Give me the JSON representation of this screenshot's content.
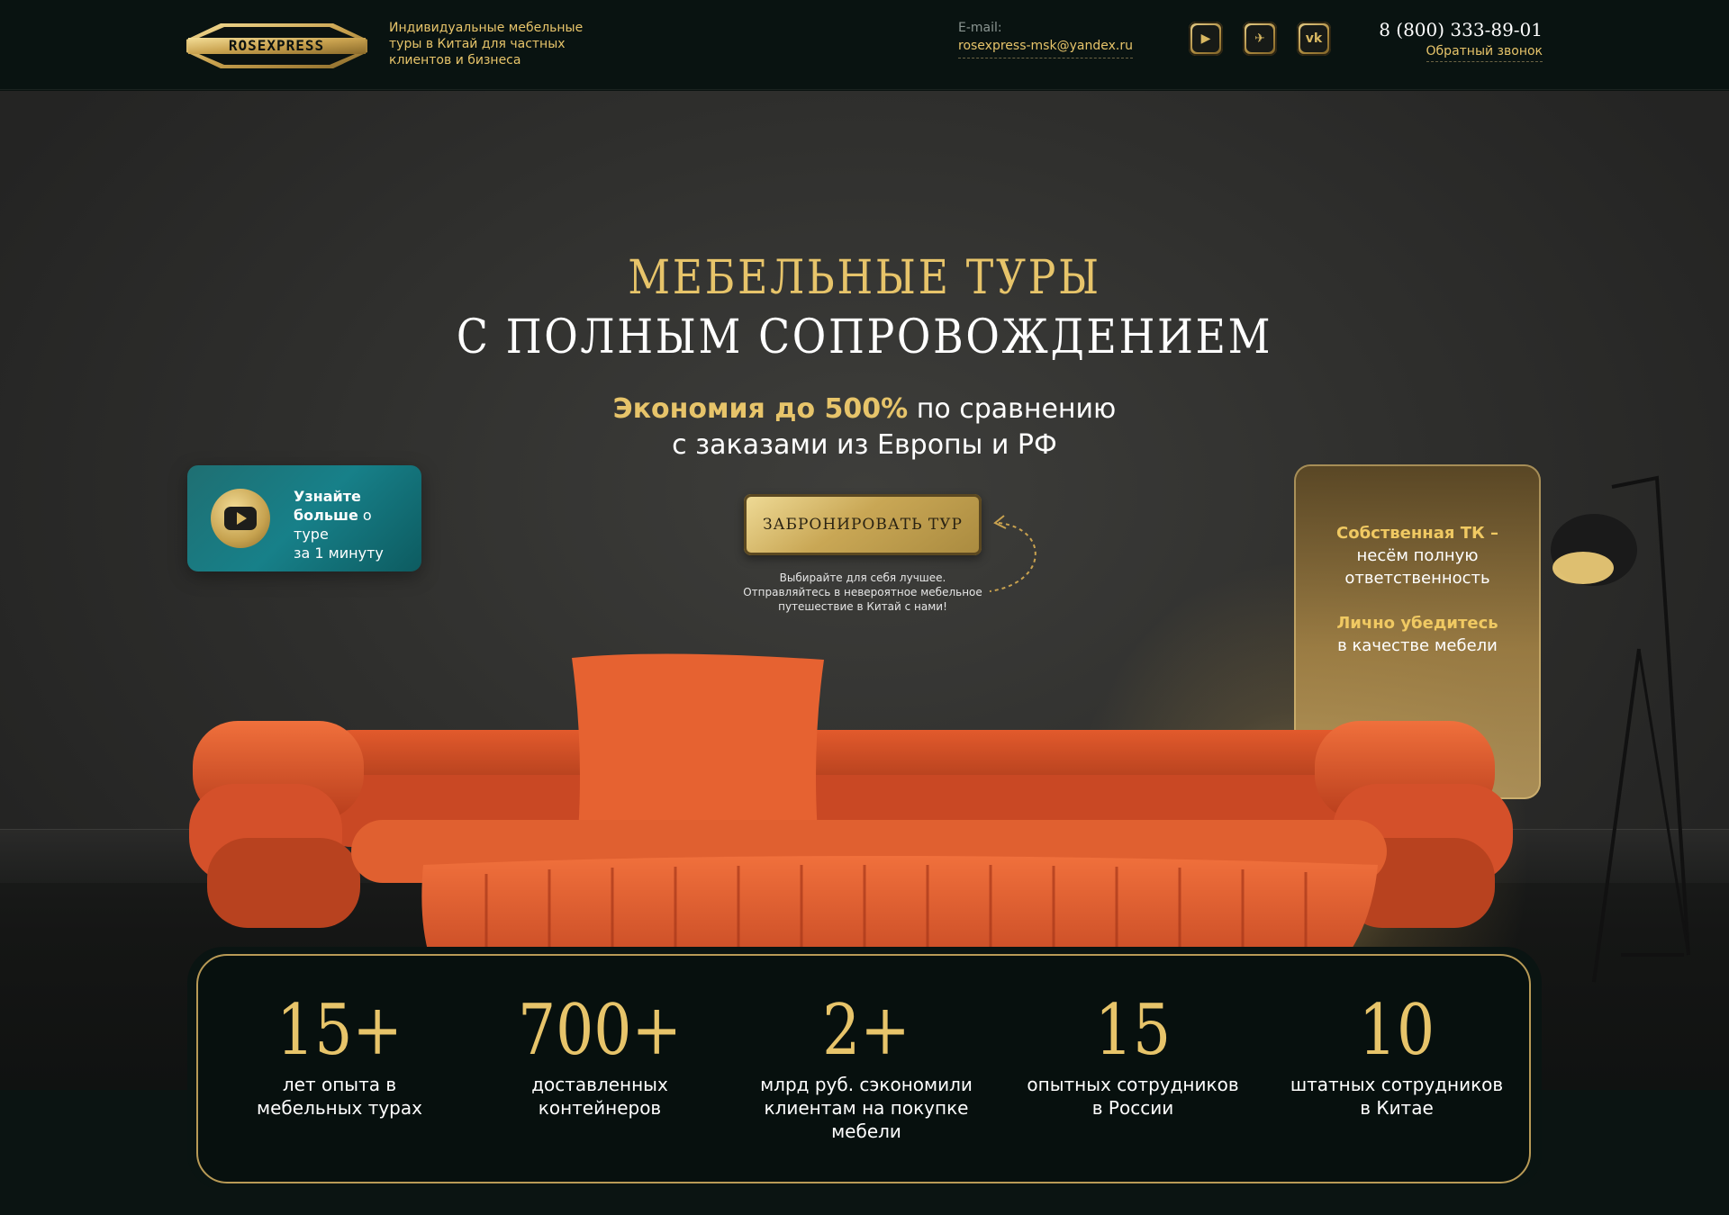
{
  "header": {
    "logo_text": "ROSEXPRESS",
    "tagline": "Индивидуальные мебельные туры в Китай для частных клиентов и бизнеса",
    "email_label": "E-mail:",
    "email": "rosexpress-msk@yandex.ru",
    "socials": [
      {
        "icon": "youtube-icon",
        "glyph": "▶"
      },
      {
        "icon": "telegram-icon",
        "glyph": "✈"
      },
      {
        "icon": "vk-icon",
        "glyph": "vk"
      }
    ],
    "phone": "8 (800) 333-89-01",
    "callback": "Обратный звонок"
  },
  "hero": {
    "title_line1": "МЕБЕЛЬНЫЕ ТУРЫ",
    "title_line2": "С ПОЛНЫМ СОПРОВОЖДЕНИЕМ",
    "subtitle_highlight": "Экономия до 500%",
    "subtitle_rest1": " по сравнению",
    "subtitle_rest2": "с заказами из Европы и РФ",
    "video_bold1": "Узнайте",
    "video_bold2": "больше",
    "video_rest2": " о туре",
    "video_rest3": "за 1 минуту",
    "cta_label": "ЗАБРОНИРОВАТЬ ТУР",
    "cta_note_line1": "Выбирайте для себя лучшее.",
    "cta_note_line2": "Отправляйтесь в невероятное мебельное",
    "cta_note_line3": "путешествие в Китай с нами!",
    "card_hl1": "Собственная ТК –",
    "card_line2": "несём полную",
    "card_line3": "ответственность",
    "card_hl2": "Лично убедитесь",
    "card_line5": "в качестве мебели"
  },
  "stats": [
    {
      "num": "15+",
      "label1": "лет опыта в",
      "label2": "мебельных турах",
      "label3": ""
    },
    {
      "num": "700+",
      "label1": "доставленных",
      "label2": "контейнеров",
      "label3": ""
    },
    {
      "num": "2+",
      "label1": "млрд руб. сэкономили",
      "label2": "клиентам на покупке",
      "label3": "мебели"
    },
    {
      "num": "15",
      "label1": "опытных сотрудников",
      "label2": "в России",
      "label3": ""
    },
    {
      "num": "10",
      "label1": "штатных сотрудников",
      "label2": "в Китае",
      "label3": ""
    }
  ],
  "colors": {
    "gold": "#e7c46a",
    "teal": "#178089",
    "sofa": "#e0562c",
    "dark": "#091311"
  }
}
